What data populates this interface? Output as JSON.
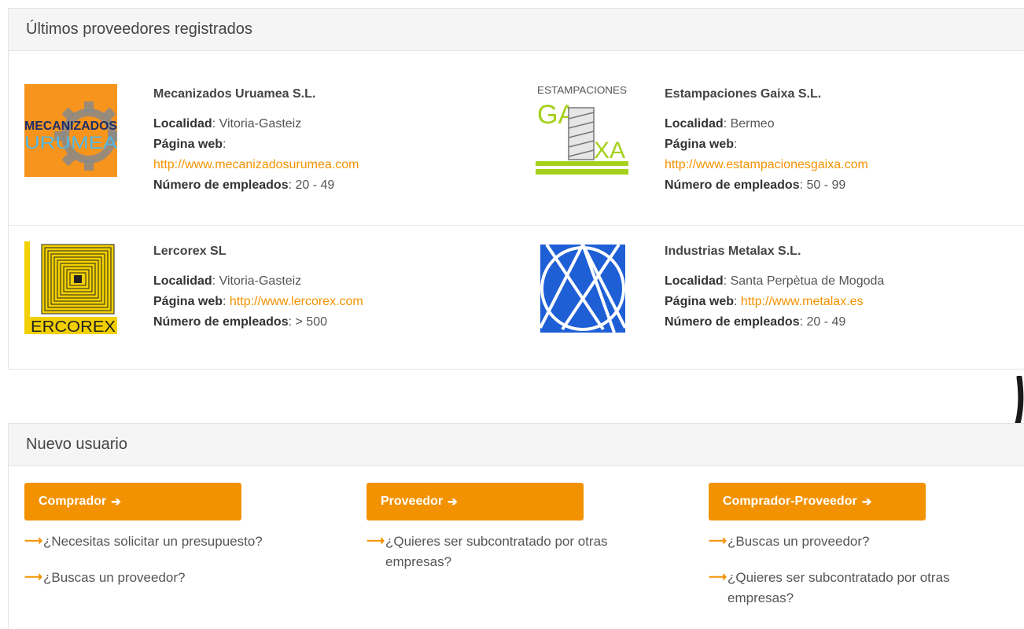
{
  "providers_panel": {
    "title": "Últimos proveedores registrados",
    "labels": {
      "locality": "Localidad",
      "website": "Página web",
      "employees": "Número de empleados"
    },
    "items": [
      {
        "name": "Mecanizados Uruamea S.L.",
        "locality": "Vitoria-Gasteiz",
        "website": "http://www.mecanizadosurumea.com",
        "employees": "20 - 49",
        "logo_text": [
          "MECANIZADOS",
          "URUMEA"
        ]
      },
      {
        "name": "Estampaciones Gaixa S.L.",
        "locality": "Bermeo",
        "website": "http://www.estampacionesgaixa.com",
        "employees": "50 - 99",
        "logo_text": [
          "ESTAMPACIONES",
          "GA",
          "XA"
        ]
      },
      {
        "name": "Lercorex SL",
        "locality": "Vitoria-Gasteiz",
        "website": "http://www.lercorex.com",
        "employees": "> 500",
        "logo_text": [
          "ERCOREX"
        ]
      },
      {
        "name": "Industrias Metalax S.L.",
        "locality": "Santa Perpètua de Mogoda",
        "website": "http://www.metalax.es",
        "employees": "20 - 49"
      }
    ]
  },
  "new_user_panel": {
    "title": "Nuevo usuario",
    "columns": [
      {
        "button": "Comprador",
        "questions": [
          "¿Necesitas solicitar un presupuesto?",
          "¿Buscas un proveedor?"
        ]
      },
      {
        "button": "Proveedor",
        "questions": [
          "¿Quieres ser subcontratado por otras empresas?"
        ]
      },
      {
        "button": "Comprador-Proveedor",
        "questions": [
          "¿Buscas un proveedor?",
          "¿Quieres ser subcontratado por otras empresas?"
        ]
      }
    ]
  },
  "colors": {
    "accent": "#f39200",
    "panel_heading_bg": "#f5f5f5",
    "logo_orange": "#f7941d",
    "logo_blue": "#1e5fd6",
    "logo_yellow": "#f2d000",
    "logo_green": "#a5d11c"
  },
  "icons": [
    "arrow-right-icon",
    "long-arrow-right-icon",
    "hand-drawn-arrow-icon"
  ]
}
